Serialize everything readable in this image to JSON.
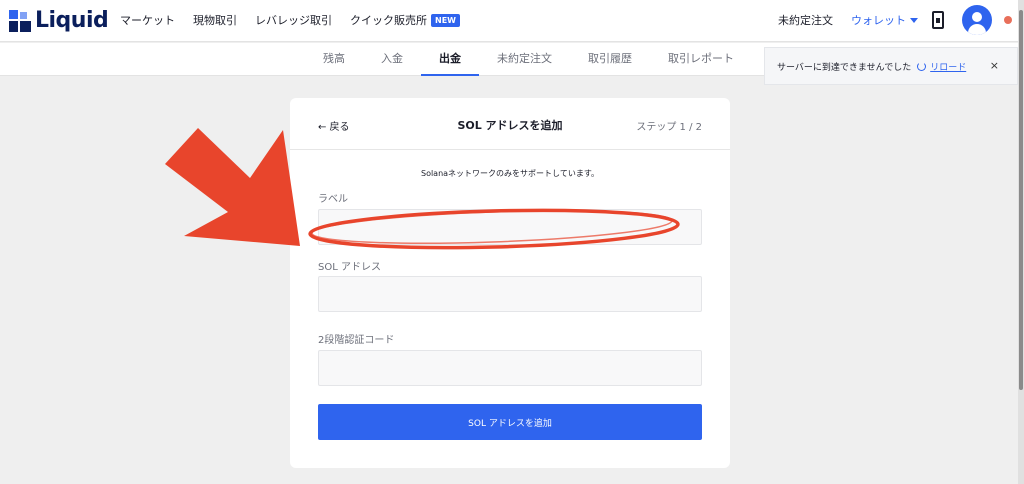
{
  "app": {
    "brand": "Liquid",
    "nav": [
      "マーケット",
      "現物取引",
      "レバレッジ取引",
      "クイック販売所"
    ],
    "new_badge": "NEW",
    "open_orders": "未約定注文",
    "wallet": "ウォレット"
  },
  "tabs": [
    "残高",
    "入金",
    "出金",
    "未約定注文",
    "取引履歴",
    "取引レポート"
  ],
  "active_tab": "出金",
  "notice": {
    "text": "サーバーに到達できませんでした",
    "reload": "リロード",
    "close": "×"
  },
  "form": {
    "back": "← 戻る",
    "title": "SOL アドレスを追加",
    "step": "ステップ 1 / 2",
    "support": "Solanaネットワークのみをサポートしています。",
    "label_field": "ラベル",
    "address_field": "SOL アドレス",
    "twofa_field": "2段階認証コード",
    "submit": "SOL アドレスを追加"
  },
  "colors": {
    "accent": "#2f64ee",
    "annotation": "#e8452c",
    "status_dot": "#e86f5a"
  },
  "icons": {
    "logo": "liquid-logo-icon",
    "wallet_caret": "chevron-down-icon",
    "phone": "mobile-app-icon",
    "avatar": "user-avatar-icon",
    "reload": "reload-icon",
    "close": "close-icon"
  }
}
